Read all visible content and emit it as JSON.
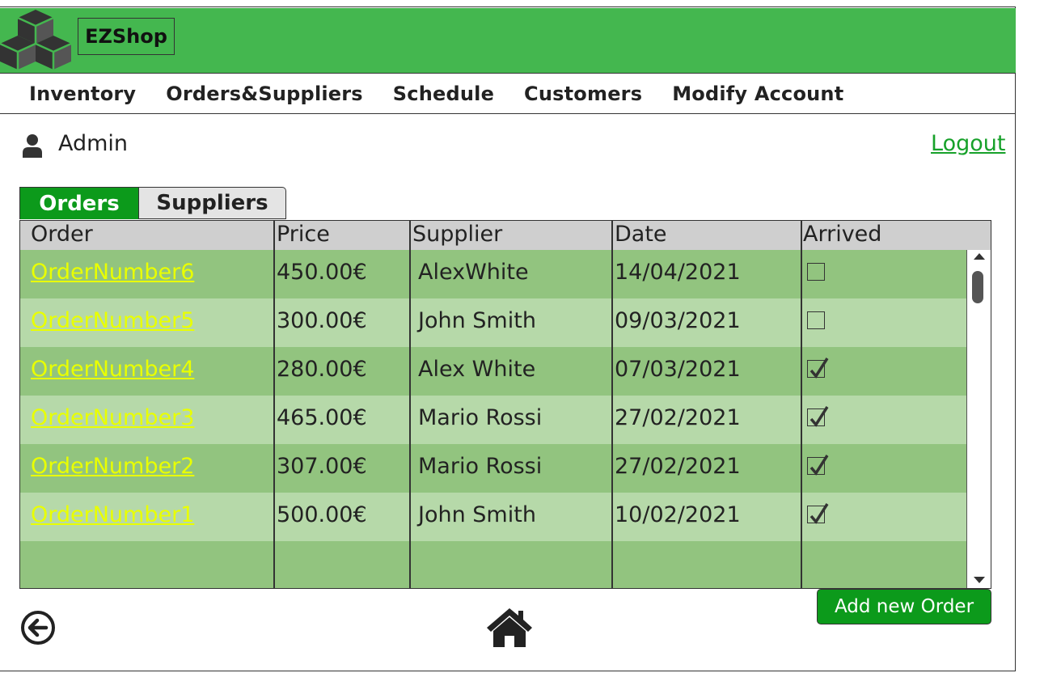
{
  "app": {
    "brand": "EZShop"
  },
  "nav": {
    "items": [
      {
        "label": "Inventory"
      },
      {
        "label": "Orders&Suppliers"
      },
      {
        "label": "Schedule"
      },
      {
        "label": "Customers"
      },
      {
        "label": "Modify Account"
      }
    ]
  },
  "user": {
    "name": "Admin",
    "icon": "user-icon",
    "logout_label": "Logout"
  },
  "tabs": [
    {
      "label": "Orders",
      "active": true
    },
    {
      "label": "Suppliers",
      "active": false
    }
  ],
  "table": {
    "columns": [
      "Order",
      "Price",
      "Supplier",
      "Date",
      "Arrived"
    ],
    "rows": [
      {
        "order": "OrderNumber6",
        "price": "450.00€",
        "supplier": "AlexWhite",
        "date": "14/04/2021",
        "arrived": false
      },
      {
        "order": "OrderNumber5",
        "price": "300.00€",
        "supplier": "John Smith",
        "date": "09/03/2021",
        "arrived": false
      },
      {
        "order": "OrderNumber4",
        "price": "280.00€",
        "supplier": "Alex White",
        "date": "07/03/2021",
        "arrived": true
      },
      {
        "order": "OrderNumber3",
        "price": "465.00€",
        "supplier": "Mario Rossi",
        "date": "27/02/2021",
        "arrived": true
      },
      {
        "order": "OrderNumber2",
        "price": "307.00€",
        "supplier": "Mario Rossi",
        "date": "27/02/2021",
        "arrived": true
      },
      {
        "order": "OrderNumber1",
        "price": "500.00€",
        "supplier": "John Smith",
        "date": "10/02/2021",
        "arrived": true
      }
    ]
  },
  "actions": {
    "add_order_label": "Add new Order",
    "back_icon": "back-arrow-icon",
    "home_icon": "home-icon"
  },
  "colors": {
    "header_green": "#44b74f",
    "accent_green": "#0c9a1b",
    "row_dark": "#92c47f",
    "row_light": "#b6d9a9",
    "link_yellow": "#e9ff00"
  }
}
